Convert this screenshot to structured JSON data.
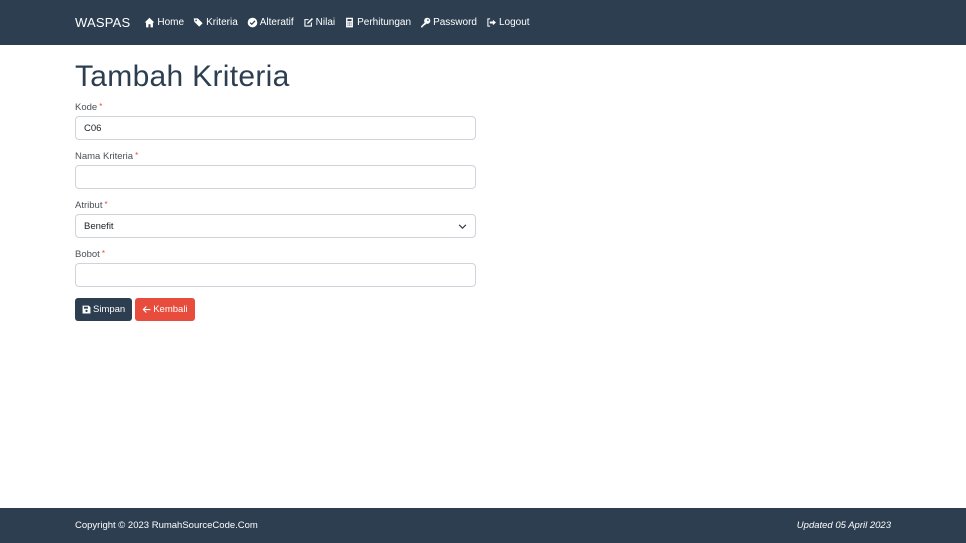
{
  "navbar": {
    "brand": "WASPAS",
    "items": [
      {
        "label": "Home",
        "icon": "home-icon"
      },
      {
        "label": "Kriteria",
        "icon": "tags-icon"
      },
      {
        "label": "Alteratif",
        "icon": "check-circle-icon"
      },
      {
        "label": "Nilai",
        "icon": "edit-icon"
      },
      {
        "label": "Perhitungan",
        "icon": "calculator-icon"
      },
      {
        "label": "Password",
        "icon": "key-icon"
      },
      {
        "label": "Logout",
        "icon": "logout-icon"
      }
    ]
  },
  "page": {
    "title": "Tambah Kriteria"
  },
  "form": {
    "required_mark": "*",
    "kode": {
      "label": "Kode",
      "value": "C06"
    },
    "nama": {
      "label": "Nama Kriteria",
      "value": ""
    },
    "atribut": {
      "label": "Atribut",
      "value": "Benefit"
    },
    "bobot": {
      "label": "Bobot",
      "value": ""
    }
  },
  "buttons": {
    "save_label": "Simpan",
    "back_label": "Kembali"
  },
  "footer": {
    "copyright": "Copyright © 2023 RumahSourceCode.Com",
    "updated": "Updated 05 April 2023"
  },
  "colors": {
    "primary": "#2c3e50",
    "danger": "#e74c3c"
  }
}
